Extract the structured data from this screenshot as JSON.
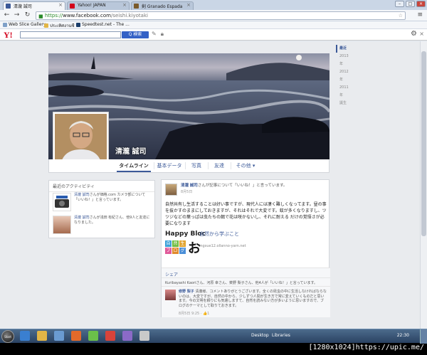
{
  "browser": {
    "tabs": [
      {
        "title": "清瀧 誠司",
        "favicon": "facebook-icon",
        "color": "#3b5998"
      },
      {
        "title": "Yahoo! JAPAN",
        "favicon": "yahoo-icon",
        "color": "#d3001b"
      },
      {
        "title": "剣 Granado Espada",
        "favicon": "game-icon",
        "color": "#7a5a2a"
      }
    ],
    "url_scheme": "https://",
    "url_host": "www.facebook.com",
    "url_path": "/seishi.kiyotaki",
    "bookmarks": [
      "Web Slice Gallery",
      "ประเทิศงานซี",
      "Speedtest.net - The ..."
    ]
  },
  "yahoo_toolbar": {
    "logo": "Y!",
    "search_placeholder": "",
    "search_button": "Q 検索"
  },
  "profile": {
    "name": "清瀧 誠司",
    "tabs": [
      "タイムライン",
      "基本データ",
      "写真",
      "友達",
      "その他 ▾"
    ]
  },
  "timeline_nav": [
    "最近",
    "2013年",
    "2012年",
    "2011年",
    "誕生"
  ],
  "activity": {
    "title": "最近のアクティビティ",
    "items": [
      {
        "text_user": "清瀧 誠司",
        "text": "さんが価格.com カメラ部について「いいね！」と言っています。",
        "thumb_label": "価格.com カメラ部"
      },
      {
        "text_user": "清瀧 誠司",
        "text": "さんが浅田 有紀さん、他9人と友達になりました。",
        "thumb_label": ""
      }
    ]
  },
  "post": {
    "author": "清瀧 誠司",
    "action": "さんが記事について「いいね！」と言っています。",
    "date": "8月5日",
    "body": "自然共有し生活することは好い事ですが、現代人には凄く難しくなってます。昼の事を抜かすのままにしておきますが、それはそれで大変です。蚊が多くなりますし、ツツジなどの葉っぱは虫たちの餌で花は咲かないし、それに耐える だけの覚悟さが必要になります",
    "link_brand": "Happy Bloc",
    "link_blocks": [
      "自",
      "然",
      "生",
      "ブ",
      "ロ",
      "グ"
    ],
    "link_big": "お",
    "link_title": "自然から学ぶこと",
    "link_url": "ingsue12.ollanno-yarn.net",
    "share_label": "シェア",
    "likes": "Kuribayashi Kaoriさん、河原 幸さん、菜野 梨子さん、他4人が「いいね！」と言っています。",
    "comment_author": "修野 梨子",
    "comment_text": "清瀧様、コメントありがとうございます。全くの昆虫の中に生活しなければならないのは、大変ですが、自然の中から、少しずつ人間が生き方で常に変えていくものだと思います。今の文明を頼りにも気遣しますて、自然を読みない方が多いように思いますので、ブログのテーマとして取りておきます。",
    "comment_time": "8月5日 9:25 · 👍1"
  },
  "taskbar": {
    "start": "Start",
    "desktop": "Desktop",
    "libraries": "Libraries",
    "clock": "22:30"
  },
  "caption": "[1280x1024]https://upic.me/"
}
